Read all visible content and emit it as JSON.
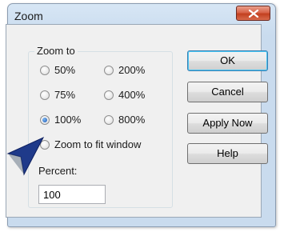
{
  "dialog": {
    "title": "Zoom",
    "close_icon": "close-x-icon"
  },
  "zoom_group": {
    "label": "Zoom to",
    "options": [
      {
        "label": "50%",
        "checked": false
      },
      {
        "label": "200%",
        "checked": false
      },
      {
        "label": "75%",
        "checked": false
      },
      {
        "label": "400%",
        "checked": false
      },
      {
        "label": "100%",
        "checked": true
      },
      {
        "label": "800%",
        "checked": false
      },
      {
        "label": "Zoom to fit window",
        "checked": false
      }
    ],
    "percent_label": "Percent:",
    "percent_value": "100"
  },
  "buttons": {
    "ok": "OK",
    "cancel": "Cancel",
    "apply_now": "Apply Now",
    "help": "Help"
  },
  "colors": {
    "close_button": "#c9462a",
    "selected_radio": "#1a58b8",
    "cursor": "#1f3a8a"
  }
}
